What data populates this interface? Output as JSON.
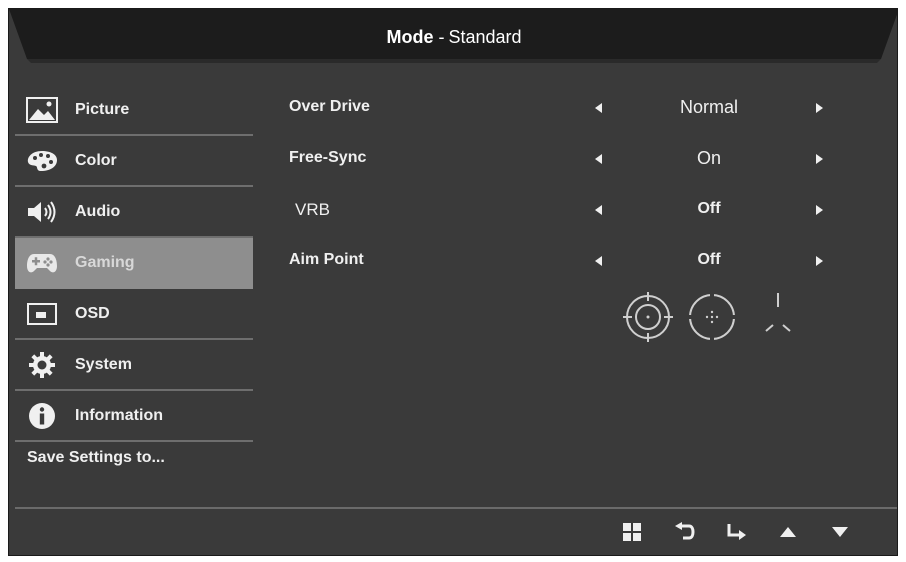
{
  "header": {
    "mode_label": "Mode",
    "mode_separator": "-",
    "mode_value": "Standard"
  },
  "sidebar": {
    "items": [
      {
        "label": "Picture",
        "icon": "picture-icon"
      },
      {
        "label": "Color",
        "icon": "palette-icon"
      },
      {
        "label": "Audio",
        "icon": "speaker-icon"
      },
      {
        "label": "Gaming",
        "icon": "gamepad-icon",
        "active": true
      },
      {
        "label": "OSD",
        "icon": "osd-icon"
      },
      {
        "label": "System",
        "icon": "gear-icon"
      },
      {
        "label": "Information",
        "icon": "info-icon"
      }
    ],
    "save_label": "Save Settings to..."
  },
  "settings": [
    {
      "label": "Over Drive",
      "value": "Normal"
    },
    {
      "label": "Free-Sync",
      "value": "On"
    },
    {
      "label": "VRB",
      "value": "Off"
    },
    {
      "label": "Aim Point",
      "value": "Off"
    }
  ],
  "aim_point_icons": [
    "crosshair-circle-icon",
    "crosshair-dotted-icon",
    "crosshair-lines-icon"
  ],
  "footer": {
    "buttons": [
      "menu-icon",
      "back-icon",
      "enter-icon",
      "up-icon",
      "down-icon"
    ]
  },
  "colors": {
    "background": "#3a3a3a",
    "title_bar": "#1e1e1e",
    "active_item": "#8e8e8e",
    "text": "#f0f0f0"
  }
}
